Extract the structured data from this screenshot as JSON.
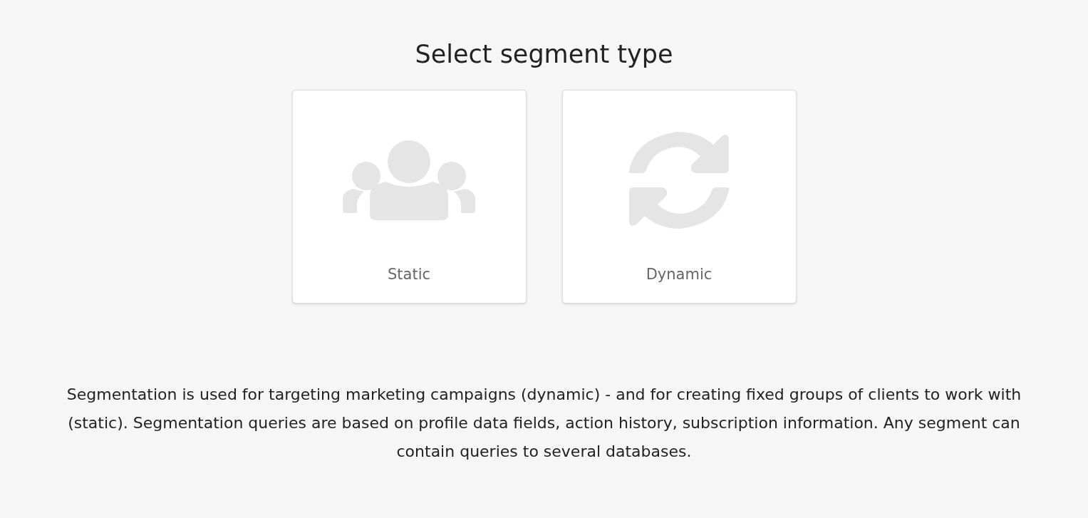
{
  "title": "Select segment type",
  "options": [
    {
      "kind": "users",
      "label": "Static"
    },
    {
      "kind": "sync",
      "label": "Dynamic"
    }
  ],
  "description": "Segmentation is used for targeting marketing campaigns (dynamic) - and for creating fixed groups of clients to work with (static). Segmentation queries are based on profile data fields, action history, subscription information. Any segment can contain queries to several databases."
}
